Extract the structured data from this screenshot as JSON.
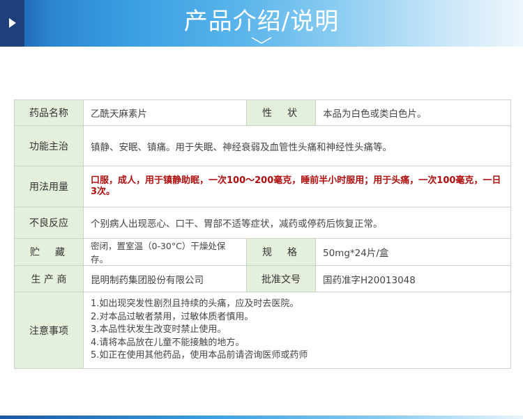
{
  "header": {
    "title": "产品介绍/说明",
    "colors": {
      "banner_dark": "#1e3f7a",
      "banner_light": "#3a9fe2",
      "label_bg": "#e4efdc",
      "warning_red": "#b00d0d"
    }
  },
  "table": {
    "name_label": "药品名称",
    "name_value": "乙酰天麻素片",
    "appearance_label": "性　状",
    "appearance_value": "本品为白色或类白色片。",
    "indication_label": "功能主治",
    "indication_value": "镇静、安眠、镇痛。用于失眠、神经衰弱及血管性头痛和神经性头痛等。",
    "dosage_label": "用法用量",
    "dosage_value": "口服，成人，用于镇静助眠，一次100～200毫克，睡前半小时服用；用于头痛，一次100毫克，一日3次。",
    "adverse_label": "不良反应",
    "adverse_value": "个别病人出现恶心、口干、胃部不适等症状，减药或停药后恢复正常。",
    "storage_label": "贮　藏",
    "storage_value": "密闭，置室温（0-30°C）干燥处保存。",
    "spec_label": "规　格",
    "spec_value": "50mg*24片/盒",
    "maker_label": "生 产 商",
    "maker_value": "昆明制药集团股份有限公司",
    "approval_label": "批准文号",
    "approval_value": "国药准字H20013048",
    "notes_label": "注意事项",
    "notes": [
      "1.如出现突发性剧烈且持续的头痛，应及时去医院。",
      "2.对本品过敏者禁用，过敏体质者慎用。",
      "3.本品性状发生改变时禁止使用。",
      "4.请将本品放在儿童不能接触的地方。",
      "5.如正在使用其他药品，使用本品前请咨询医师或药师"
    ]
  }
}
